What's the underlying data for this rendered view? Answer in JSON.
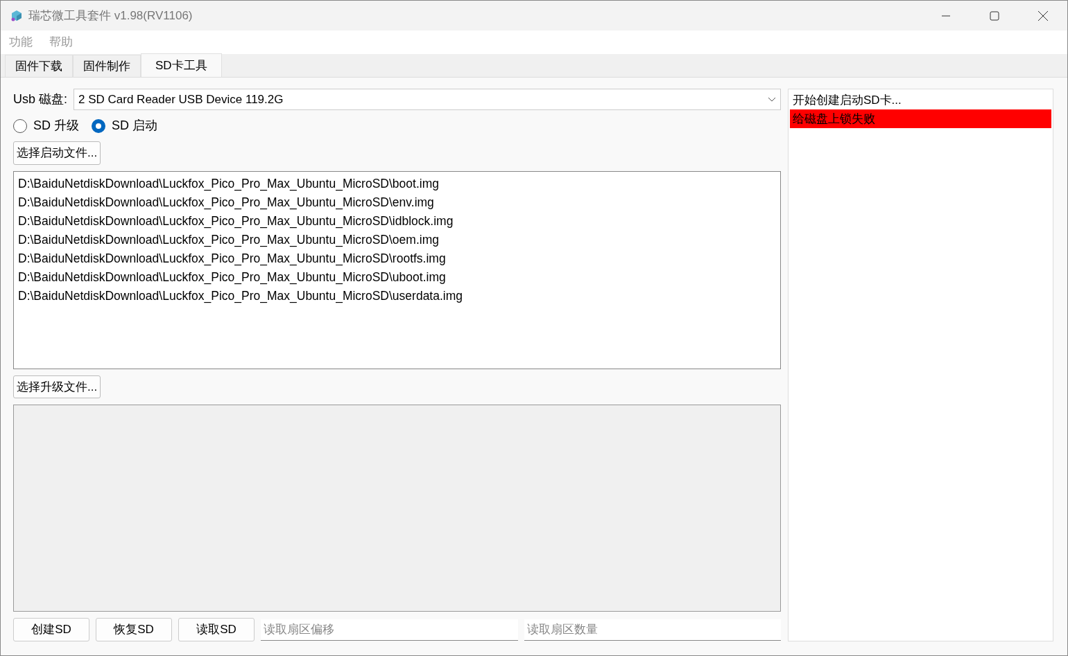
{
  "window": {
    "title": "瑞芯微工具套件 v1.98(RV1106)"
  },
  "menu": [
    "功能",
    "帮助"
  ],
  "tabs": [
    {
      "label": "固件下载",
      "selected": false
    },
    {
      "label": "固件制作",
      "selected": false
    },
    {
      "label": "SD卡工具",
      "selected": true
    }
  ],
  "usb_disk": {
    "label": "Usb 磁盘:",
    "value": "2 SD Card Reader USB Device 119.2G"
  },
  "modes": [
    {
      "label": "SD 升级",
      "selected": false
    },
    {
      "label": "SD 启动",
      "selected": true
    }
  ],
  "boot_button": "选择启动文件...",
  "boot_files": [
    "D:\\BaiduNetdiskDownload\\Luckfox_Pico_Pro_Max_Ubuntu_MicroSD\\boot.img",
    "D:\\BaiduNetdiskDownload\\Luckfox_Pico_Pro_Max_Ubuntu_MicroSD\\env.img",
    "D:\\BaiduNetdiskDownload\\Luckfox_Pico_Pro_Max_Ubuntu_MicroSD\\idblock.img",
    "D:\\BaiduNetdiskDownload\\Luckfox_Pico_Pro_Max_Ubuntu_MicroSD\\oem.img",
    "D:\\BaiduNetdiskDownload\\Luckfox_Pico_Pro_Max_Ubuntu_MicroSD\\rootfs.img",
    "D:\\BaiduNetdiskDownload\\Luckfox_Pico_Pro_Max_Ubuntu_MicroSD\\uboot.img",
    "D:\\BaiduNetdiskDownload\\Luckfox_Pico_Pro_Max_Ubuntu_MicroSD\\userdata.img"
  ],
  "upgrade_button": "选择升级文件...",
  "actions": [
    "创建SD",
    "恢复SD",
    "读取SD"
  ],
  "fields": [
    {
      "placeholder": "读取扇区偏移"
    },
    {
      "placeholder": "读取扇区数量"
    }
  ],
  "log": [
    {
      "text": "开始创建启动SD卡...",
      "color": "#ffffff"
    },
    {
      "text": "给磁盘上锁失败",
      "color": "#ff0000"
    }
  ]
}
